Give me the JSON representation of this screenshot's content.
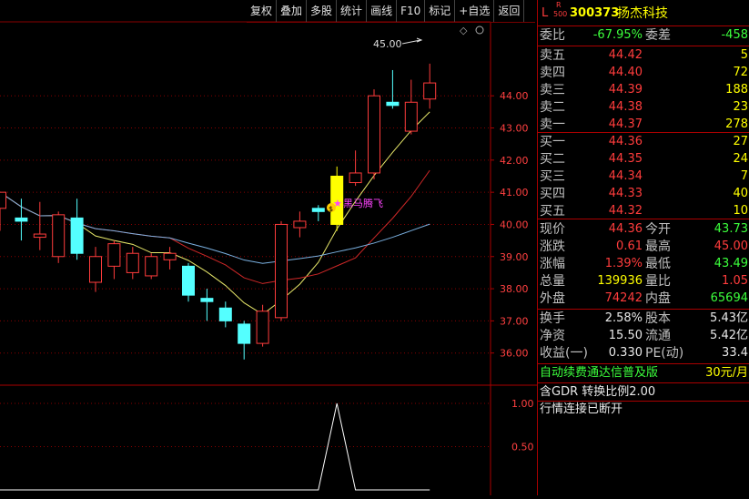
{
  "toolbar": {
    "buttons": [
      "复权",
      "叠加",
      "多股",
      "统计",
      "画线",
      "F10",
      "标记",
      "+自选",
      "返回"
    ]
  },
  "stock": {
    "market_flag": "L",
    "r_flag": "R",
    "index_flag": "500",
    "code": "300373",
    "name": "扬杰科技"
  },
  "chart_annotations": {
    "high_label": "45.00",
    "signal_label": "黑马腾飞",
    "coin_glyph": "$",
    "diamond_glyph": "◇"
  },
  "chart_data": [
    {
      "type": "candlestick",
      "y_ticks": [
        "44.00",
        "43.00",
        "42.00",
        "41.00",
        "40.00",
        "39.00",
        "38.00",
        "37.00",
        "36.00"
      ],
      "ylim": [
        35.0,
        46.3
      ],
      "candles": [
        {
          "o": 40.5,
          "c": 41.0,
          "h": 41.0,
          "l": 39.8
        },
        {
          "o": 40.2,
          "c": 40.1,
          "h": 40.8,
          "l": 39.5
        },
        {
          "o": 39.6,
          "c": 39.7,
          "h": 40.7,
          "l": 39.2
        },
        {
          "o": 39.0,
          "c": 40.3,
          "h": 40.4,
          "l": 38.8
        },
        {
          "o": 40.2,
          "c": 39.1,
          "h": 40.8,
          "l": 38.9
        },
        {
          "o": 38.2,
          "c": 39.0,
          "h": 39.3,
          "l": 37.9
        },
        {
          "o": 38.7,
          "c": 39.4,
          "h": 39.5,
          "l": 38.3
        },
        {
          "o": 38.5,
          "c": 39.1,
          "h": 39.3,
          "l": 38.3
        },
        {
          "o": 38.4,
          "c": 39.0,
          "h": 39.1,
          "l": 38.3
        },
        {
          "o": 38.9,
          "c": 39.1,
          "h": 39.3,
          "l": 38.6
        },
        {
          "o": 38.7,
          "c": 37.8,
          "h": 38.8,
          "l": 37.6
        },
        {
          "o": 37.7,
          "c": 37.6,
          "h": 38.0,
          "l": 37.0
        },
        {
          "o": 37.4,
          "c": 37.0,
          "h": 37.6,
          "l": 36.8
        },
        {
          "o": 36.9,
          "c": 36.3,
          "h": 37.0,
          "l": 35.8
        },
        {
          "o": 36.3,
          "c": 37.3,
          "h": 37.5,
          "l": 36.2
        },
        {
          "o": 37.1,
          "c": 40.0,
          "h": 40.1,
          "l": 37.0
        },
        {
          "o": 39.9,
          "c": 40.1,
          "h": 40.4,
          "l": 39.6
        },
        {
          "o": 40.5,
          "c": 40.4,
          "h": 40.6,
          "l": 40.1
        },
        {
          "o": 40.0,
          "c": 41.5,
          "h": 41.8,
          "l": 39.8
        },
        {
          "o": 41.3,
          "c": 41.6,
          "h": 42.3,
          "l": 41.2
        },
        {
          "o": 41.6,
          "c": 44.0,
          "h": 44.2,
          "l": 41.4
        },
        {
          "o": 43.8,
          "c": 43.7,
          "h": 44.8,
          "l": 43.6
        },
        {
          "o": 42.9,
          "c": 43.8,
          "h": 44.5,
          "l": 42.8
        },
        {
          "o": 43.9,
          "c": 44.4,
          "h": 45.0,
          "l": 43.6
        }
      ],
      "highlight_index": 18
    },
    {
      "type": "line",
      "y_ticks": [
        "1.00",
        "0.50"
      ],
      "ylim": [
        0,
        1.2
      ],
      "values": [
        0,
        0,
        0,
        0,
        0,
        0,
        0,
        0,
        0,
        0,
        0,
        0,
        0,
        0,
        0,
        0,
        0,
        0,
        1,
        0,
        0,
        0,
        0,
        0
      ]
    }
  ],
  "quote": {
    "weibi_label": "委比",
    "weibi_value": "-67.95%",
    "weicha_label": "委差",
    "weicha_value": "-458",
    "asks": [
      {
        "label": "卖五",
        "price": "44.42",
        "vol": "5"
      },
      {
        "label": "卖四",
        "price": "44.40",
        "vol": "72"
      },
      {
        "label": "卖三",
        "price": "44.39",
        "vol": "188"
      },
      {
        "label": "卖二",
        "price": "44.38",
        "vol": "23"
      },
      {
        "label": "卖一",
        "price": "44.37",
        "vol": "278"
      }
    ],
    "bids": [
      {
        "label": "买一",
        "price": "44.36",
        "vol": "27"
      },
      {
        "label": "买二",
        "price": "44.35",
        "vol": "24"
      },
      {
        "label": "买三",
        "price": "44.34",
        "vol": "7"
      },
      {
        "label": "买四",
        "price": "44.33",
        "vol": "40"
      },
      {
        "label": "买五",
        "price": "44.32",
        "vol": "10"
      }
    ],
    "stats": [
      {
        "l1": "现价",
        "v1": "44.36",
        "c1": "red",
        "l2": "今开",
        "v2": "43.73",
        "c2": "green"
      },
      {
        "l1": "涨跌",
        "v1": "0.61",
        "c1": "red",
        "l2": "最高",
        "v2": "45.00",
        "c2": "red"
      },
      {
        "l1": "涨幅",
        "v1": "1.39%",
        "c1": "red",
        "l2": "最低",
        "v2": "43.49",
        "c2": "green"
      },
      {
        "l1": "总量",
        "v1": "139936",
        "c1": "yellow",
        "l2": "量比",
        "v2": "1.05",
        "c2": "red"
      },
      {
        "l1": "外盘",
        "v1": "74242",
        "c1": "red",
        "l2": "内盘",
        "v2": "65694",
        "c2": "green"
      }
    ],
    "fin": [
      {
        "l1": "换手",
        "v1": "2.58%",
        "l2": "股本",
        "v2": "5.43亿"
      },
      {
        "l1": "净资",
        "v1": "15.50",
        "l2": "流通",
        "v2": "5.42亿"
      },
      {
        "l1": "收益(一)",
        "v1": "0.330",
        "l2": "PE(动)",
        "v2": "33.4"
      }
    ],
    "ad_text": "自动续费通达信普及版",
    "ad_price": "30元/月",
    "gdr_text": "含GDR 转换比例2.00",
    "status_text": "行情连接已断开"
  }
}
